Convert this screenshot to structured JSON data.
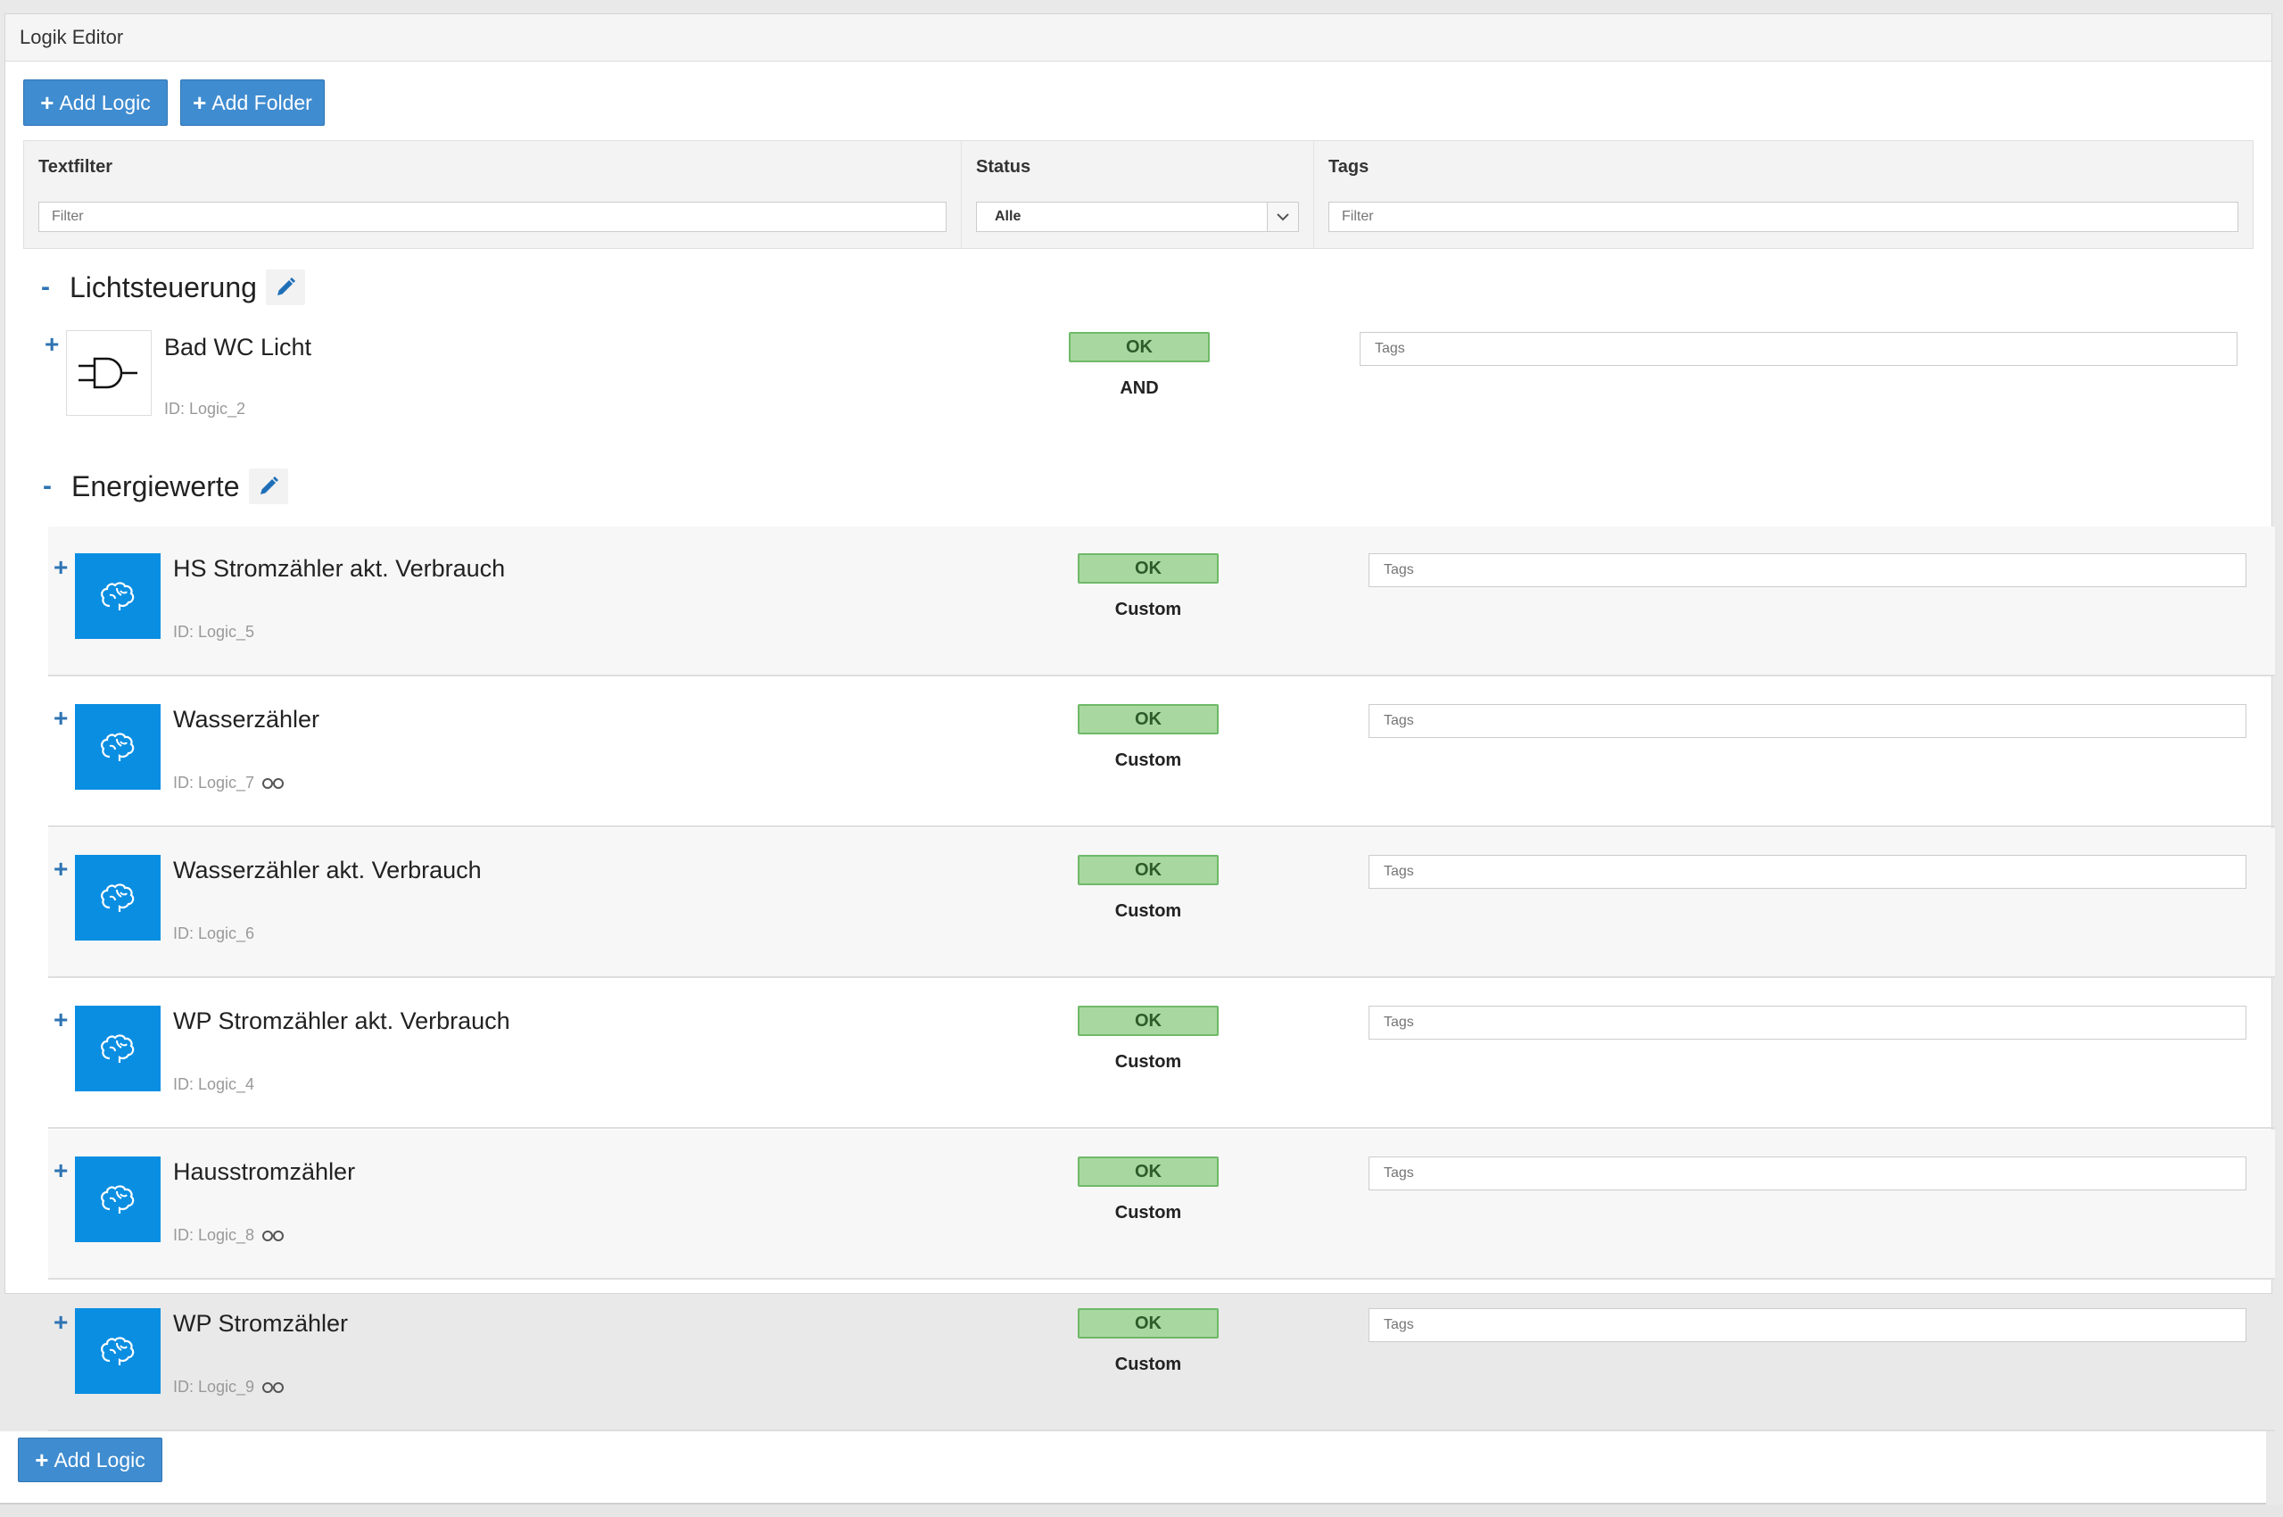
{
  "panel": {
    "title": "Logik Editor"
  },
  "toolbar": {
    "add_logic_label": "Add Logic",
    "add_folder_label": "Add Folder"
  },
  "filters": {
    "textfilter_header": "Textfilter",
    "status_header": "Status",
    "tags_header": "Tags",
    "text_placeholder": "Filter",
    "status_value": "Alle",
    "tags_placeholder": "Filter"
  },
  "folders": [
    {
      "toggle": "-",
      "name": "Lichtsteuerung",
      "items": [
        {
          "title": "Bad WC Licht",
          "id": "ID: Logic_2",
          "status": "OK",
          "type": "AND",
          "tags_placeholder": "Tags",
          "icon": "and-gate-icon"
        }
      ]
    },
    {
      "toggle": "-",
      "name": "Energiewerte",
      "items": [
        {
          "title": "HS Stromzähler akt. Verbrauch",
          "id": "ID: Logic_5",
          "status": "OK",
          "type": "Custom",
          "tags_placeholder": "Tags",
          "icon": "brain-icon"
        },
        {
          "title": "Wasserzähler",
          "id": "ID: Logic_7",
          "linked": true,
          "status": "OK",
          "type": "Custom",
          "tags_placeholder": "Tags",
          "icon": "brain-icon"
        },
        {
          "title": "Wasserzähler akt. Verbrauch",
          "id": "ID: Logic_6",
          "status": "OK",
          "type": "Custom",
          "tags_placeholder": "Tags",
          "icon": "brain-icon"
        },
        {
          "title": "WP Stromzähler akt. Verbrauch",
          "id": "ID: Logic_4",
          "status": "OK",
          "type": "Custom",
          "tags_placeholder": "Tags",
          "icon": "brain-icon"
        },
        {
          "title": "Hausstromzähler",
          "id": "ID: Logic_8",
          "linked": true,
          "status": "OK",
          "type": "Custom",
          "tags_placeholder": "Tags",
          "icon": "brain-icon"
        },
        {
          "title": "WP Stromzähler",
          "id": "ID: Logic_9",
          "linked": true,
          "status": "OK",
          "type": "Custom",
          "tags_placeholder": "Tags",
          "icon": "brain-icon"
        }
      ]
    }
  ],
  "bottom": {
    "add_logic_label": "Add Logic"
  },
  "colors": {
    "primary": "#3f8cd0",
    "status_ok_bg": "#a8d8a0",
    "icon_bg": "#0a8ee2"
  }
}
